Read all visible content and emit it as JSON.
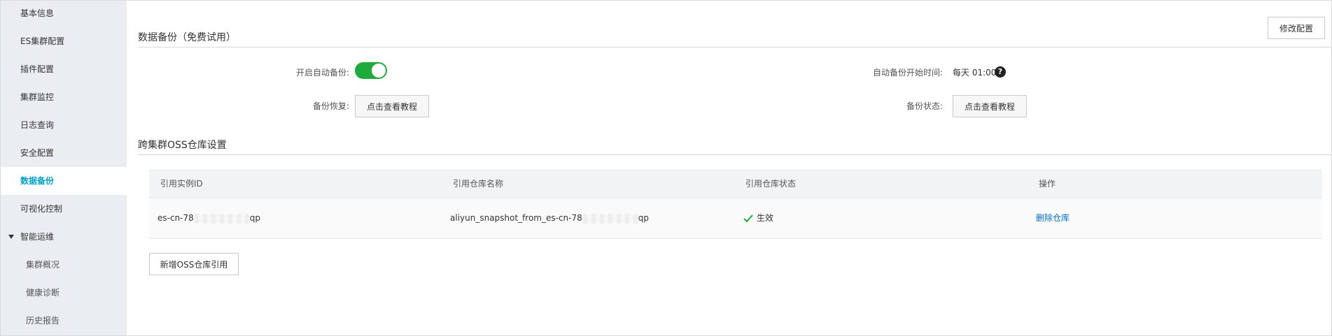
{
  "sidebar": {
    "items": [
      {
        "label": "基本信息"
      },
      {
        "label": "ES集群配置"
      },
      {
        "label": "插件配置"
      },
      {
        "label": "集群监控"
      },
      {
        "label": "日志查询"
      },
      {
        "label": "安全配置"
      },
      {
        "label": "数据备份",
        "active": true
      },
      {
        "label": "可视化控制"
      },
      {
        "label": "智能运维",
        "expanded": true
      },
      {
        "label": "集群概况"
      },
      {
        "label": "健康诊断"
      },
      {
        "label": "历史报告"
      }
    ]
  },
  "header": {
    "modify_button": "修改配置"
  },
  "backup": {
    "title": "数据备份（免费试用）",
    "auto_backup_label": "开启自动备份:",
    "auto_backup_enabled": true,
    "start_time_label": "自动备份开始时间:",
    "start_time_value": "每天 01:00",
    "help_icon": "question-circle-icon",
    "restore_label": "备份恢复:",
    "restore_button": "点击查看教程",
    "status_label": "备份状态:",
    "status_button": "点击查看教程"
  },
  "oss": {
    "title": "跨集群OSS仓库设置",
    "columns": [
      "引用实例ID",
      "引用仓库名称",
      "引用仓库状态",
      "操作"
    ],
    "rows": [
      {
        "instance_id_prefix": "es-cn-78",
        "instance_id_suffix": "qp",
        "repo_name_prefix": "aliyun_snapshot_from_es-cn-78",
        "repo_name_suffix": "qp",
        "status_icon": "check-icon",
        "status": "生效",
        "action": "删除仓库"
      }
    ],
    "add_button": "新增OSS仓库引用"
  },
  "colors": {
    "accent": "#00a2ca",
    "toggle_on": "#1eab3c",
    "link": "#0070cc",
    "status_ok": "#1eab3c"
  }
}
